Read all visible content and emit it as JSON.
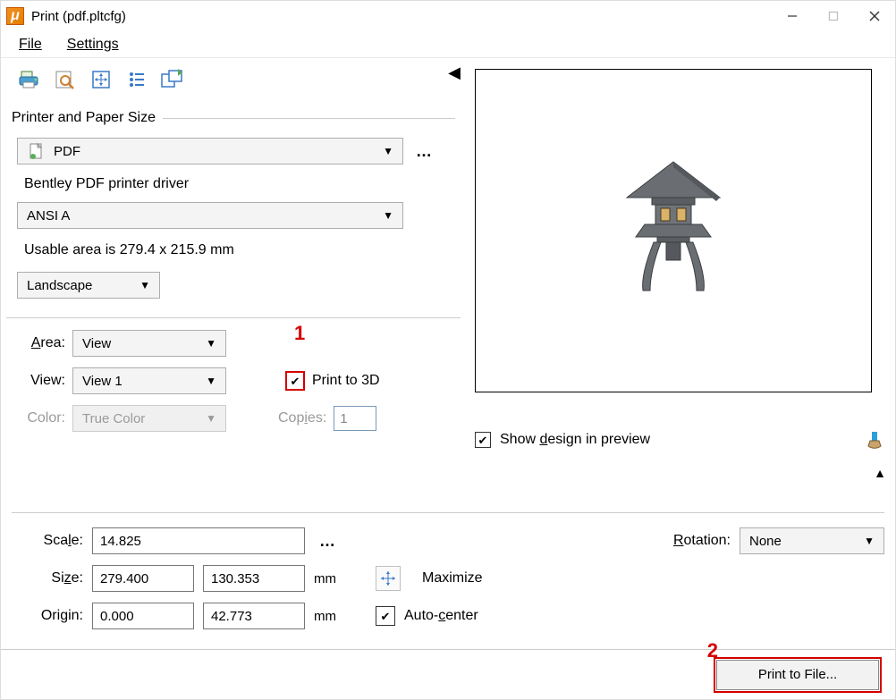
{
  "window": {
    "app_icon_glyph": "μ",
    "title": "Print  (pdf.pltcfg)"
  },
  "window_controls": {
    "minimize": "minimize",
    "maximize": "maximize",
    "close": "close"
  },
  "menubar": {
    "file": "File",
    "settings": "Settings"
  },
  "toolbar": {
    "print_icon": "print-icon",
    "preview_icon": "print-preview-icon",
    "fit_icon": "fit-view-icon",
    "list_icon": "print-attributes-icon",
    "update_icon": "update-from-view-icon"
  },
  "printer_group": {
    "title": "Printer and Paper Size",
    "printer_value": "PDF",
    "more_button": "…",
    "driver_text": "Bentley PDF printer driver",
    "paper_value": "ANSI A",
    "usable_text": "Usable area is 279.4 x 215.9 mm",
    "orientation_value": "Landscape"
  },
  "area_group": {
    "area_label_pre": "",
    "area_label_ul": "A",
    "area_label_post": "rea:",
    "area_value": "View",
    "view_label": "View:",
    "view_value": "View 1",
    "color_label": "Color:",
    "color_value": "True Color",
    "print3d_label": "Print to 3D",
    "copies_label_pre": "Cop",
    "copies_label_ul": "i",
    "copies_label_post": "es:",
    "copies_value": "1"
  },
  "preview": {
    "show_design_label_pre": "Show ",
    "show_design_ul": "d",
    "show_design_post": "esign in preview"
  },
  "lower": {
    "scale_label_pre": "Sca",
    "scale_label_ul": "l",
    "scale_label_post": "e:",
    "scale_value": "14.825",
    "scale_more": "…",
    "rotation_label_pre": "",
    "rotation_ul": "R",
    "rotation_post": "otation:",
    "rotation_value": "None",
    "size_label_pre": "Si",
    "size_label_ul": "z",
    "size_label_post": "e:",
    "size_w": "279.400",
    "size_h": "130.353",
    "size_unit": "mm",
    "maximize_label": "Maximize",
    "origin_label_pre": "Ori",
    "origin_label_ul": "g",
    "origin_label_post": "in:",
    "origin_x": "0.000",
    "origin_y": "42.773",
    "origin_unit": "mm",
    "autocenter_label_pre": "Auto-",
    "autocenter_ul": "c",
    "autocenter_post": "enter"
  },
  "footer": {
    "print_button": "Print to File..."
  },
  "callouts": {
    "one": "1",
    "two": "2"
  }
}
